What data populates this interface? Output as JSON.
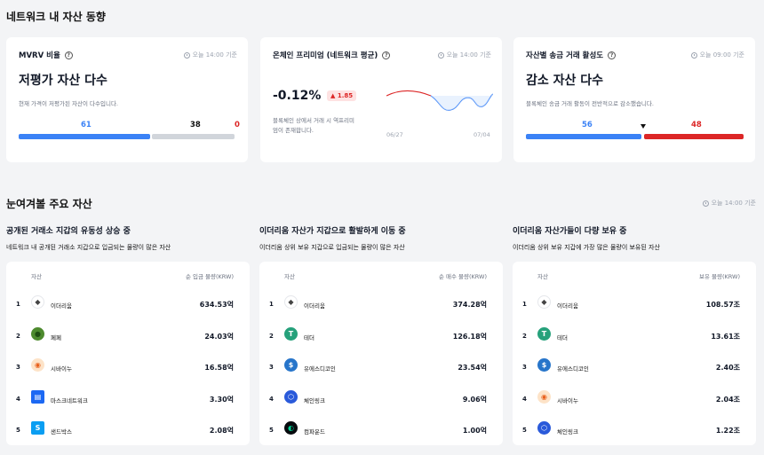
{
  "network_section": {
    "title": "네트워크 내 자산 동향"
  },
  "cards": {
    "mvrv": {
      "title": "MVRV 비율",
      "time": "오늘 14:00 기준",
      "headline": "저평가 자산 다수",
      "desc": "현재 가격이 저평가된 자산이 다수입니다.",
      "left_value": "61",
      "mid_value": "38",
      "right_value": "0"
    },
    "premium": {
      "title": "온체인 프리미엄 (네트워크 평균)",
      "time": "오늘 14:00 기준",
      "value": "-0.12%",
      "delta": "▲ 1.85",
      "desc_line1": "블록체인 상에서 거래 시 역프리미",
      "desc_line2": "엄이 존재합니다.",
      "x_start": "06/27",
      "x_end": "07/04"
    },
    "activity": {
      "title": "자산별 송금 거래 활성도",
      "time": "오늘 09:00 기준",
      "headline": "감소 자산 다수",
      "desc": "블록체인 송금 거래 활동이 전반적으로 감소했습니다.",
      "left_value": "56",
      "right_value": "48"
    }
  },
  "watch_section": {
    "title": "눈여겨볼 주요 자산",
    "time": "오늘 14:00 기준"
  },
  "columns": [
    {
      "title": "공개된 거래소 지갑의 유동성 상승 중",
      "subtitle": "네트워크 내 공개된 거래소 지갑으로 입금되는 물량이 많은 자산",
      "header_asset": "자산",
      "header_value": "순 입금 물량(KRW)",
      "rows": [
        {
          "rank": "1",
          "name": "이더리움",
          "value": "634.53억",
          "icon": "ethereum-icon"
        },
        {
          "rank": "2",
          "name": "페페",
          "value": "24.03억",
          "icon": "pepe-icon"
        },
        {
          "rank": "3",
          "name": "시바이누",
          "value": "16.58억",
          "icon": "shiba-inu-icon"
        },
        {
          "rank": "4",
          "name": "마스크네트워크",
          "value": "3.30억",
          "icon": "mask-network-icon"
        },
        {
          "rank": "5",
          "name": "샌드박스",
          "value": "2.08억",
          "icon": "sandbox-icon"
        }
      ]
    },
    {
      "title": "이더리움 자산가 지갑으로 활발하게 이동 중",
      "subtitle": "이더리움 상위 보유 지갑으로 입금되는 물량이 많은 자산",
      "header_asset": "자산",
      "header_value": "순 매수 물량(KRW)",
      "rows": [
        {
          "rank": "1",
          "name": "이더리움",
          "value": "374.28억",
          "icon": "ethereum-icon"
        },
        {
          "rank": "2",
          "name": "테더",
          "value": "126.18억",
          "icon": "tether-icon"
        },
        {
          "rank": "3",
          "name": "유에스디코인",
          "value": "23.54억",
          "icon": "usdc-icon"
        },
        {
          "rank": "4",
          "name": "체인링크",
          "value": "9.06억",
          "icon": "chainlink-icon"
        },
        {
          "rank": "5",
          "name": "컴파운드",
          "value": "1.00억",
          "icon": "compound-icon"
        }
      ]
    },
    {
      "title": "이더리움 자산가들이 다량 보유 중",
      "subtitle": "이더리움 상위 보유 지갑에 가장 많은 물량이 보유된 자산",
      "header_asset": "자산",
      "header_value": "보유 물량(KRW)",
      "rows": [
        {
          "rank": "1",
          "name": "이더리움",
          "value": "108.57조",
          "icon": "ethereum-icon"
        },
        {
          "rank": "2",
          "name": "테더",
          "value": "13.61조",
          "icon": "tether-icon"
        },
        {
          "rank": "3",
          "name": "유에스디코인",
          "value": "2.40조",
          "icon": "usdc-icon"
        },
        {
          "rank": "4",
          "name": "시바이누",
          "value": "2.04조",
          "icon": "shiba-inu-icon"
        },
        {
          "rank": "5",
          "name": "체인링크",
          "value": "1.22조",
          "icon": "chainlink-icon"
        }
      ]
    }
  ],
  "colors": {
    "blue": "#3b82f6",
    "red": "#dc2626",
    "gray": "#d1d5db"
  }
}
